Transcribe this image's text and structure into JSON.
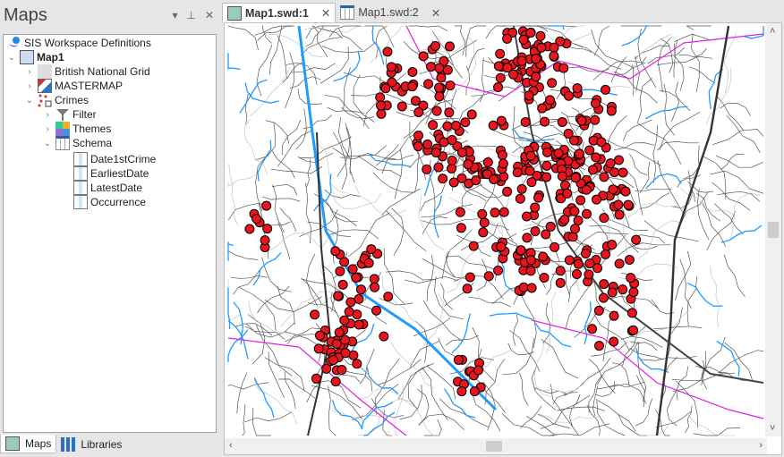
{
  "panel": {
    "title": "Maps",
    "buttons": {
      "dropdown": "▾",
      "pin": "⊥",
      "close": "✕"
    }
  },
  "tree": {
    "root": "SIS Workspace Definitions",
    "map": "Map1",
    "layers": [
      "British National Grid",
      "MASTERMAP",
      "Crimes"
    ],
    "crimes_children": [
      "Filter",
      "Themes",
      "Schema"
    ],
    "schema_fields": [
      "Date1stCrime",
      "EarliestDate",
      "LatestDate",
      "Occurrence"
    ]
  },
  "panel_tabs": [
    "Maps",
    "Libraries"
  ],
  "doc_tabs": [
    {
      "label": "Map1.swd:1",
      "active": true
    },
    {
      "label": "Map1.swd:2",
      "active": false
    }
  ],
  "close_glyph": "✕",
  "colors": {
    "crime_marker": "#e8141e",
    "road": "#333333",
    "water": "#1e9bff",
    "boundary": "#e020e0"
  }
}
